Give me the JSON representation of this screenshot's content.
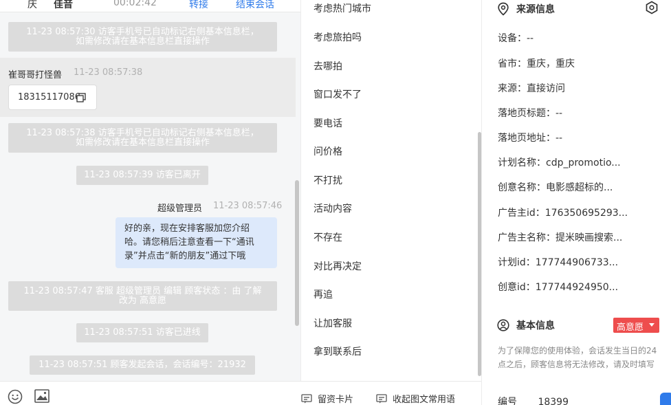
{
  "topbar": {
    "name_left": "庆",
    "name": "佳音",
    "duration": "00:02:42",
    "transfer": "转接",
    "end": "结束会话"
  },
  "messages": {
    "sys1": [
      "11-23 08:57:30 访客手机号已自动标记右侧基本信息栏，",
      "如需修改请在基本信息栏直接操作"
    ],
    "visitor_name": "崔哥哥打怪兽",
    "visitor_time": "11-23 08:57:38",
    "visitor_phone": "18315117086",
    "sys2": [
      "11-23 08:57:38 访客手机号已自动标记右侧基本信息栏，",
      "如需修改请在基本信息栏直接操作"
    ],
    "sys3": "11-23 08:57:39 访客已离开",
    "agent_name": "超级管理员",
    "agent_time": "11-23 08:57:46",
    "agent_text": [
      "好的亲，现在安排客服加您介绍",
      "哈。请您稍后注意查看一下“通讯",
      "录”并点击“新的朋友”通过下哦"
    ],
    "sys4": [
      "11-23 08:57:47 客服 超级管理员 编辑 顾客状态 ：由 了解",
      "改为 高意愿"
    ],
    "sys5": "11-23 08:57:51 访客已进线",
    "sys6": "11-23 08:57:51 顾客发起会话，会话编号：21932"
  },
  "composer": {
    "card_label": "留资卡片",
    "collapse_label": "收起图文常用语"
  },
  "quick_replies": [
    "考虑热门城市",
    "考虑旅拍吗",
    "去哪拍",
    "窗口发不了",
    "要电话",
    "问价格",
    "不打扰",
    "活动内容",
    "不存在",
    "对比再决定",
    "再追",
    "让加客服",
    "拿到联系后"
  ],
  "source": {
    "title": "来源信息",
    "rows": [
      "设备：--",
      "省市：重庆，重庆",
      "来源：直接访问",
      "落地页标题：--",
      "落地页地址：--",
      "计划名称：cdp_promotio...",
      "创意名称：电影感超标的...",
      "广告主id：176350695293...",
      "广告主名称：提米映画搜索...",
      "计划id：177744906733...",
      "创意id：177744924950..."
    ]
  },
  "basic": {
    "title": "基本信息",
    "intent": "高意愿",
    "notice": "为了保障您的使用体验，会话发生当日的24点之后，顾客信息将无法修改，请及时填写",
    "id_label": "编号",
    "id_value": "18399"
  },
  "colors": {
    "accent": "#2f7bea",
    "intent": "#ee4d4d",
    "agent_bubble": "#dde9fb",
    "system": "#dcdcdc"
  }
}
